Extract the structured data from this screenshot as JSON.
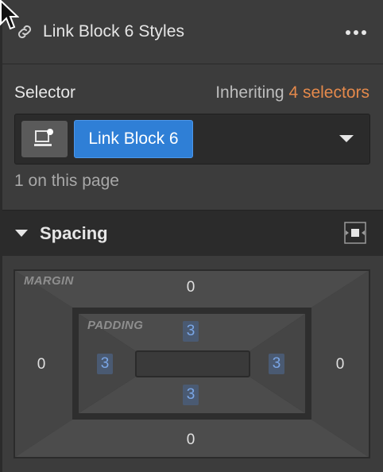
{
  "header": {
    "title": "Link Block 6 Styles",
    "icon": "link-icon",
    "menu_icon": "more-horizontal-icon"
  },
  "selector": {
    "label": "Selector",
    "inheriting_prefix": "Inheriting",
    "inheriting_count": "4 selectors",
    "tag": "Link Block 6",
    "state_icon": "state-icon",
    "count_text": "1 on this page",
    "accent_color": "#e4894b",
    "tag_color": "#2f7fd6"
  },
  "spacing": {
    "title": "Spacing",
    "margin_label": "MARGIN",
    "padding_label": "PADDING",
    "margin": {
      "top": "0",
      "right": "0",
      "bottom": "0",
      "left": "0"
    },
    "padding": {
      "top": "3",
      "right": "3",
      "bottom": "3",
      "left": "3"
    }
  }
}
